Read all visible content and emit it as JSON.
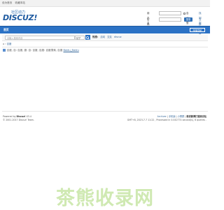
{
  "topbar": {
    "set_home": "设为首页",
    "favorite": "收藏本站"
  },
  "logo": {
    "cn": "社区动力",
    "en": "DISCUZ!"
  },
  "login": {
    "username_label": "用户名",
    "password_label": "密码",
    "auto_login": "自动登录",
    "retrieve_password": "找回密码",
    "login_button": "登录",
    "register": "立即注册"
  },
  "nav": {
    "home": "首页",
    "quick_nav": "快捷导航"
  },
  "search": {
    "placeholder": "请输入搜索内容",
    "type": "帖子",
    "button_icon": "search-icon",
    "hot_label": "热搜:",
    "hot_items": [
      "活动",
      "交友",
      "discuz"
    ]
  },
  "breadcrumb": {
    "home": "首页",
    "sep": "›",
    "current": "百度"
  },
  "result": {
    "prefix": "百度, 百: 百度, 度: 百: 百度, 百度: 百度搜索, 百度",
    "link": "Baidu_Baidu"
  },
  "footer_left": {
    "powered": "Powered by",
    "brand": "Discuz!",
    "version": "X3.4",
    "copyright": "© 2001-2017 Discuz! Team."
  },
  "footer_right": {
    "links": [
      "Archiver",
      "手机版",
      "小黑屋",
      "新浪微博打猎测试站"
    ],
    "info": "GMT+8, 2023-7-7 11:22 , Processed in 0.042774 second(s), 6 queries ."
  },
  "watermark": "茶熊收录网"
}
